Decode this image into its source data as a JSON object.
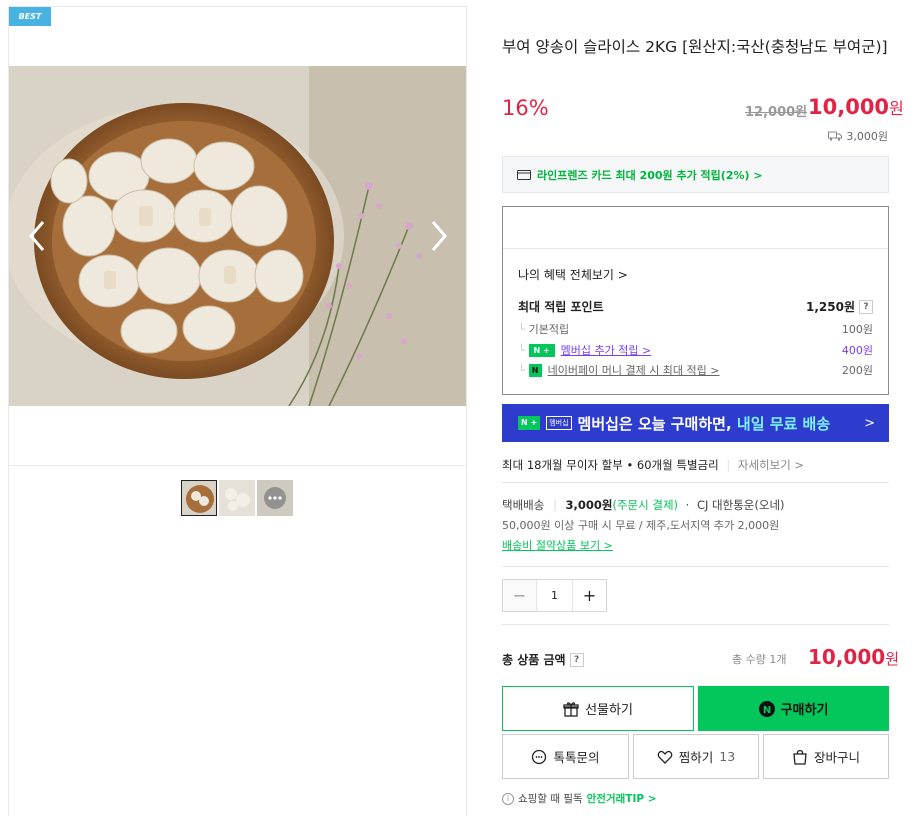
{
  "badge": "BEST",
  "product": {
    "title": "부여 양송이 슬라이스 2KG [원산지:국산(충청남도 부여군)]",
    "discount": "16%",
    "original_price": "12,000원",
    "sale_price": "10,000",
    "sale_price_unit": "원",
    "shipping_fee": "3,000원"
  },
  "card_promo": "라인프렌즈 카드 최대 200원 추가 적립(2%) >",
  "benefits": {
    "all_label": "나의 혜택 전체보기 >",
    "max_label": "최대 적립 포인트",
    "max_value": "1,250원",
    "help": "?",
    "rows": [
      {
        "label": "기본적립",
        "value": "100원"
      },
      {
        "label": "멤버십 추가 적립 >",
        "value": "400원"
      },
      {
        "label": "네이버페이 머니 결제 시 최대 적립 >",
        "value": "200원"
      }
    ]
  },
  "membership": {
    "tag": "N +",
    "tag2": "멤버십",
    "text_a": "멤버십은 오늘 구매하면, ",
    "text_b": "내일 무료 배송",
    "arrow": ">"
  },
  "installment": {
    "text": "최대 18개월 무이자 할부 • 60개월 특별금리",
    "more": "자세히보기 >"
  },
  "shipping": {
    "method": "택배배송",
    "fee": "3,000원",
    "fee_note": "(주문시 결제)",
    "carrier": "CJ 대한통운(오네)",
    "note": "50,000원 이상 구매 시 무료 / 제주,도서지역 추가 2,000원",
    "link": "배송비 절약상품 보기 >"
  },
  "quantity": {
    "minus": "−",
    "value": "1",
    "plus": "+"
  },
  "total": {
    "label": "총 상품 금액",
    "help": "?",
    "count": "총 수량 1개",
    "price": "10,000",
    "unit": "원"
  },
  "buttons": {
    "gift": "선물하기",
    "buy": "구매하기",
    "talk": "톡톡문의",
    "zzim": "찜하기",
    "zzim_count": "13",
    "cart": "장바구니"
  },
  "tip": {
    "prefix": "쇼핑할 때 필독",
    "link": "안전거래TIP >"
  },
  "colors": {
    "accent_green": "#03c75a",
    "price_red": "#e12346",
    "membership_blue": "#2d3ccc",
    "badge_blue": "#48b3e3"
  }
}
